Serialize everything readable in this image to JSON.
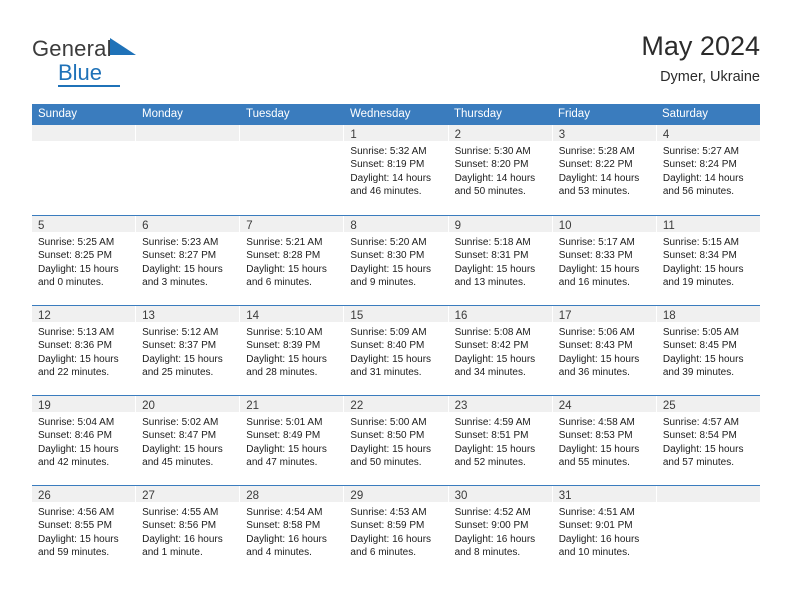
{
  "brand": {
    "line1": "General",
    "line2": "Blue",
    "triangle_color": "#1f72b8"
  },
  "header": {
    "title": "May 2024",
    "subtitle": "Dymer, Ukraine"
  },
  "theme": {
    "header_blue": "#3a7cbe",
    "date_band_gray": "#f0f0f0",
    "text_dark": "#1c1c1c"
  },
  "day_names": [
    "Sunday",
    "Monday",
    "Tuesday",
    "Wednesday",
    "Thursday",
    "Friday",
    "Saturday"
  ],
  "weeks": [
    [
      {
        "empty": true
      },
      {
        "empty": true
      },
      {
        "empty": true
      },
      {
        "date": "1",
        "sunrise": "Sunrise: 5:32 AM",
        "sunset": "Sunset: 8:19 PM",
        "daylight1": "Daylight: 14 hours",
        "daylight2": "and 46 minutes."
      },
      {
        "date": "2",
        "sunrise": "Sunrise: 5:30 AM",
        "sunset": "Sunset: 8:20 PM",
        "daylight1": "Daylight: 14 hours",
        "daylight2": "and 50 minutes."
      },
      {
        "date": "3",
        "sunrise": "Sunrise: 5:28 AM",
        "sunset": "Sunset: 8:22 PM",
        "daylight1": "Daylight: 14 hours",
        "daylight2": "and 53 minutes."
      },
      {
        "date": "4",
        "sunrise": "Sunrise: 5:27 AM",
        "sunset": "Sunset: 8:24 PM",
        "daylight1": "Daylight: 14 hours",
        "daylight2": "and 56 minutes."
      }
    ],
    [
      {
        "date": "5",
        "sunrise": "Sunrise: 5:25 AM",
        "sunset": "Sunset: 8:25 PM",
        "daylight1": "Daylight: 15 hours",
        "daylight2": "and 0 minutes."
      },
      {
        "date": "6",
        "sunrise": "Sunrise: 5:23 AM",
        "sunset": "Sunset: 8:27 PM",
        "daylight1": "Daylight: 15 hours",
        "daylight2": "and 3 minutes."
      },
      {
        "date": "7",
        "sunrise": "Sunrise: 5:21 AM",
        "sunset": "Sunset: 8:28 PM",
        "daylight1": "Daylight: 15 hours",
        "daylight2": "and 6 minutes."
      },
      {
        "date": "8",
        "sunrise": "Sunrise: 5:20 AM",
        "sunset": "Sunset: 8:30 PM",
        "daylight1": "Daylight: 15 hours",
        "daylight2": "and 9 minutes."
      },
      {
        "date": "9",
        "sunrise": "Sunrise: 5:18 AM",
        "sunset": "Sunset: 8:31 PM",
        "daylight1": "Daylight: 15 hours",
        "daylight2": "and 13 minutes."
      },
      {
        "date": "10",
        "sunrise": "Sunrise: 5:17 AM",
        "sunset": "Sunset: 8:33 PM",
        "daylight1": "Daylight: 15 hours",
        "daylight2": "and 16 minutes."
      },
      {
        "date": "11",
        "sunrise": "Sunrise: 5:15 AM",
        "sunset": "Sunset: 8:34 PM",
        "daylight1": "Daylight: 15 hours",
        "daylight2": "and 19 minutes."
      }
    ],
    [
      {
        "date": "12",
        "sunrise": "Sunrise: 5:13 AM",
        "sunset": "Sunset: 8:36 PM",
        "daylight1": "Daylight: 15 hours",
        "daylight2": "and 22 minutes."
      },
      {
        "date": "13",
        "sunrise": "Sunrise: 5:12 AM",
        "sunset": "Sunset: 8:37 PM",
        "daylight1": "Daylight: 15 hours",
        "daylight2": "and 25 minutes."
      },
      {
        "date": "14",
        "sunrise": "Sunrise: 5:10 AM",
        "sunset": "Sunset: 8:39 PM",
        "daylight1": "Daylight: 15 hours",
        "daylight2": "and 28 minutes."
      },
      {
        "date": "15",
        "sunrise": "Sunrise: 5:09 AM",
        "sunset": "Sunset: 8:40 PM",
        "daylight1": "Daylight: 15 hours",
        "daylight2": "and 31 minutes."
      },
      {
        "date": "16",
        "sunrise": "Sunrise: 5:08 AM",
        "sunset": "Sunset: 8:42 PM",
        "daylight1": "Daylight: 15 hours",
        "daylight2": "and 34 minutes."
      },
      {
        "date": "17",
        "sunrise": "Sunrise: 5:06 AM",
        "sunset": "Sunset: 8:43 PM",
        "daylight1": "Daylight: 15 hours",
        "daylight2": "and 36 minutes."
      },
      {
        "date": "18",
        "sunrise": "Sunrise: 5:05 AM",
        "sunset": "Sunset: 8:45 PM",
        "daylight1": "Daylight: 15 hours",
        "daylight2": "and 39 minutes."
      }
    ],
    [
      {
        "date": "19",
        "sunrise": "Sunrise: 5:04 AM",
        "sunset": "Sunset: 8:46 PM",
        "daylight1": "Daylight: 15 hours",
        "daylight2": "and 42 minutes."
      },
      {
        "date": "20",
        "sunrise": "Sunrise: 5:02 AM",
        "sunset": "Sunset: 8:47 PM",
        "daylight1": "Daylight: 15 hours",
        "daylight2": "and 45 minutes."
      },
      {
        "date": "21",
        "sunrise": "Sunrise: 5:01 AM",
        "sunset": "Sunset: 8:49 PM",
        "daylight1": "Daylight: 15 hours",
        "daylight2": "and 47 minutes."
      },
      {
        "date": "22",
        "sunrise": "Sunrise: 5:00 AM",
        "sunset": "Sunset: 8:50 PM",
        "daylight1": "Daylight: 15 hours",
        "daylight2": "and 50 minutes."
      },
      {
        "date": "23",
        "sunrise": "Sunrise: 4:59 AM",
        "sunset": "Sunset: 8:51 PM",
        "daylight1": "Daylight: 15 hours",
        "daylight2": "and 52 minutes."
      },
      {
        "date": "24",
        "sunrise": "Sunrise: 4:58 AM",
        "sunset": "Sunset: 8:53 PM",
        "daylight1": "Daylight: 15 hours",
        "daylight2": "and 55 minutes."
      },
      {
        "date": "25",
        "sunrise": "Sunrise: 4:57 AM",
        "sunset": "Sunset: 8:54 PM",
        "daylight1": "Daylight: 15 hours",
        "daylight2": "and 57 minutes."
      }
    ],
    [
      {
        "date": "26",
        "sunrise": "Sunrise: 4:56 AM",
        "sunset": "Sunset: 8:55 PM",
        "daylight1": "Daylight: 15 hours",
        "daylight2": "and 59 minutes."
      },
      {
        "date": "27",
        "sunrise": "Sunrise: 4:55 AM",
        "sunset": "Sunset: 8:56 PM",
        "daylight1": "Daylight: 16 hours",
        "daylight2": "and 1 minute."
      },
      {
        "date": "28",
        "sunrise": "Sunrise: 4:54 AM",
        "sunset": "Sunset: 8:58 PM",
        "daylight1": "Daylight: 16 hours",
        "daylight2": "and 4 minutes."
      },
      {
        "date": "29",
        "sunrise": "Sunrise: 4:53 AM",
        "sunset": "Sunset: 8:59 PM",
        "daylight1": "Daylight: 16 hours",
        "daylight2": "and 6 minutes."
      },
      {
        "date": "30",
        "sunrise": "Sunrise: 4:52 AM",
        "sunset": "Sunset: 9:00 PM",
        "daylight1": "Daylight: 16 hours",
        "daylight2": "and 8 minutes."
      },
      {
        "date": "31",
        "sunrise": "Sunrise: 4:51 AM",
        "sunset": "Sunset: 9:01 PM",
        "daylight1": "Daylight: 16 hours",
        "daylight2": "and 10 minutes."
      },
      {
        "empty": true
      }
    ]
  ]
}
